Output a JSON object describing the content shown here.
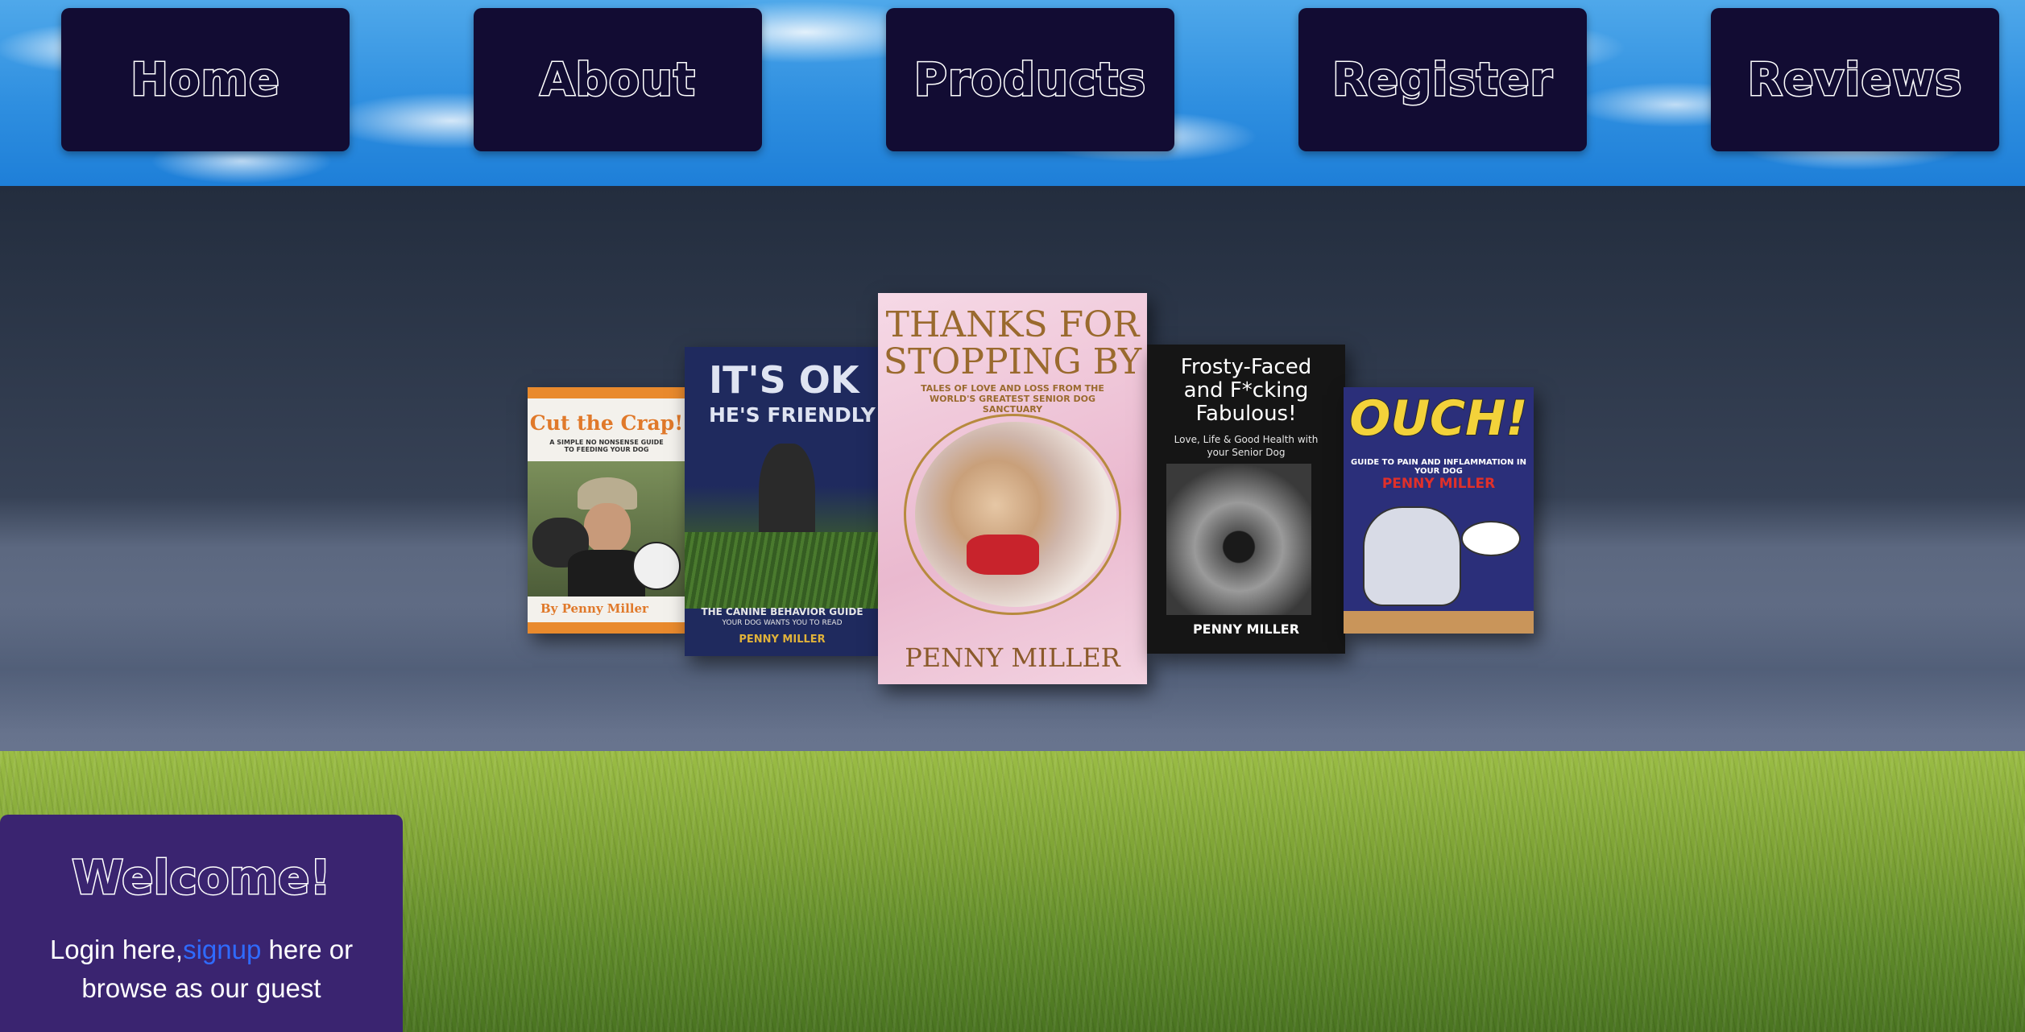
{
  "nav": {
    "items": [
      {
        "label": "Home"
      },
      {
        "label": "About"
      },
      {
        "label": "Products"
      },
      {
        "label": "Register"
      },
      {
        "label": "Reviews"
      }
    ]
  },
  "books": [
    {
      "title": "Cut the Crap!",
      "subtitle": "A SIMPLE NO NONSENSE GUIDE TO FEEDING YOUR DOG",
      "author": "By Penny Miller",
      "accent": "#e98a2d"
    },
    {
      "title_line1": "IT'S OK",
      "title_line2": "HE'S FRIENDLY",
      "subtitle": "THE CANINE BEHAVIOR GUIDE",
      "subtitle2": "YOUR DOG WANTS YOU TO READ",
      "author": "PENNY MILLER"
    },
    {
      "title_line1": "THANKS FOR",
      "title_line2": "STOPPING BY",
      "subtitle": "TALES OF LOVE AND LOSS FROM THE WORLD'S GREATEST SENIOR DOG SANCTUARY",
      "author": "PENNY MILLER"
    },
    {
      "title": "Frosty-Faced and F*cking Fabulous!",
      "subtitle": "Love, Life & Good Health with your Senior Dog",
      "author": "PENNY MILLER"
    },
    {
      "title": "OUCH!",
      "subtitle": "GUIDE TO PAIN AND INFLAMMATION IN YOUR DOG",
      "author": "PENNY MILLER"
    }
  ],
  "welcome": {
    "heading": "Welcome!",
    "text_before": "Login here,",
    "signup_link": "signup",
    "text_after": " here or browse as our guest"
  },
  "colors": {
    "nav_bg": "#120c33",
    "welcome_bg": "#3a2470",
    "link": "#2f6bff"
  }
}
